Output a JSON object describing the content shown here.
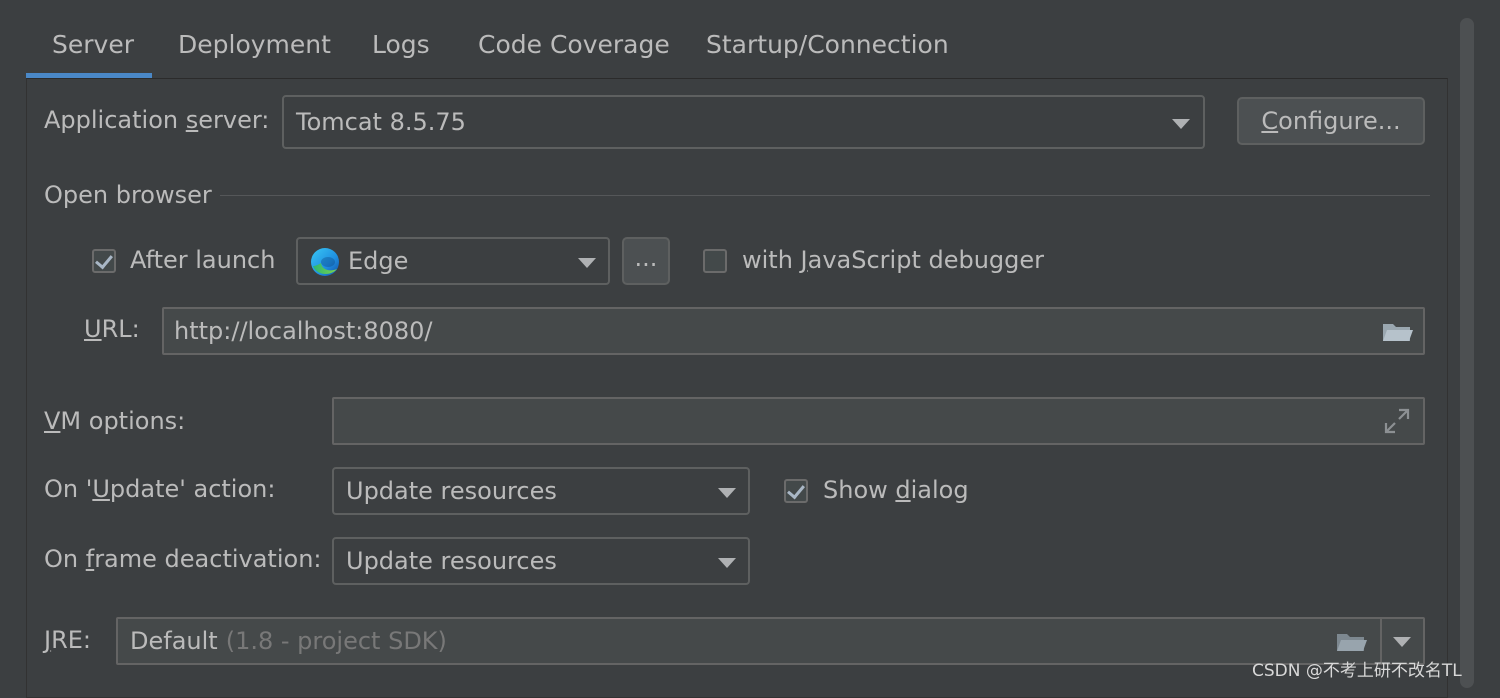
{
  "tabs": [
    {
      "label": "Server",
      "active": true
    },
    {
      "label": "Deployment"
    },
    {
      "label": "Logs"
    },
    {
      "label": "Code Coverage"
    },
    {
      "label": "Startup/Connection"
    }
  ],
  "app_server": {
    "label_pre": "Application ",
    "label_mnemonic": "s",
    "label_post": "erver:",
    "value": "Tomcat 8.5.75",
    "configure_mnemonic": "C",
    "configure_rest": "onfigure..."
  },
  "open_browser": {
    "section_title": "Open browser",
    "after_launch_label": "After launch",
    "after_launch_checked": true,
    "browser": "Edge",
    "ellipsis": "...",
    "js_debugger_pre": "with ",
    "js_debugger_mnemonic": "J",
    "js_debugger_post": "avaScript debugger",
    "js_debugger_checked": false,
    "url_mnemonic": "U",
    "url_label_rest": "RL:",
    "url_value": "http://localhost:8080/"
  },
  "vm_options": {
    "label_mnemonic": "V",
    "label_rest": "M options:",
    "value": ""
  },
  "update_action": {
    "label_pre": "On '",
    "label_mnemonic": "U",
    "label_post": "pdate' action:",
    "value": "Update resources",
    "show_dialog_pre": "Show ",
    "show_dialog_mnemonic": "d",
    "show_dialog_post": "ialog",
    "show_dialog_checked": true
  },
  "frame_deactivation": {
    "label_pre": "On ",
    "label_mnemonic": "f",
    "label_post": "rame deactivation:",
    "value": "Update resources"
  },
  "jre": {
    "label_mnemonic": "J",
    "label_rest": "RE:",
    "value": "Default",
    "hint": "(1.8 - project SDK)"
  },
  "watermark": "CSDN @不考上研不改名TL",
  "colors": {
    "background": "#3c3f41",
    "tab_underline": "#4a88c7",
    "field_background": "#45494a"
  }
}
